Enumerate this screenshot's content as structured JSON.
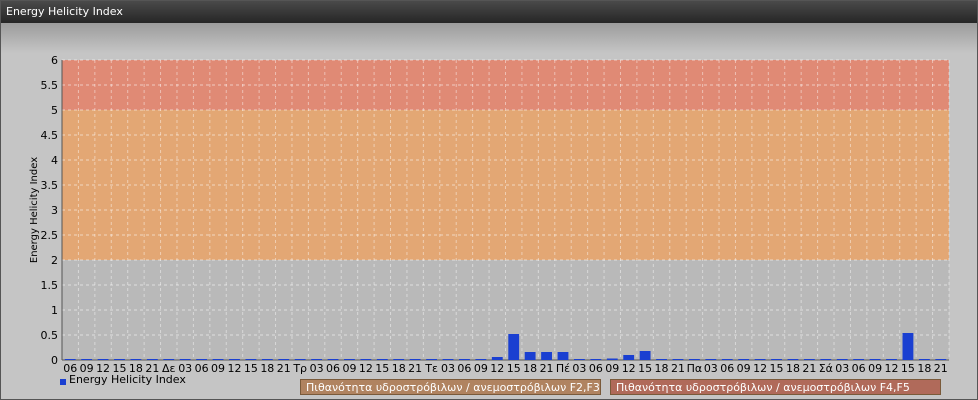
{
  "window": {
    "title": "Energy Helicity Index"
  },
  "legend": {
    "series_label": "Energy Helicity Index"
  },
  "probability_boxes": [
    {
      "label": "Πιθανότητα υδροστρόβιλων / ανεμοστρόβιλων F2,F3",
      "color": "#b08360"
    },
    {
      "label": "Πιθανότητα υδροστρόβιλων / ανεμοστρόβιλων F4,F5",
      "color": "#b06a5a"
    }
  ],
  "chart_data": {
    "type": "bar",
    "ylabel": "Energy Helicity Index",
    "ylim": [
      0,
      6
    ],
    "yticks": [
      "0",
      "0.5",
      "1",
      "1.5",
      "2",
      "2.5",
      "3",
      "3.5",
      "4",
      "4.5",
      "5",
      "5.5",
      "6"
    ],
    "grid": true,
    "legend_position": "bottom-left",
    "bands": [
      {
        "from": 0,
        "to": 2,
        "color": "#b9b9b9"
      },
      {
        "from": 2,
        "to": 5,
        "color": "#e3a774"
      },
      {
        "from": 5,
        "to": 6,
        "color": "#e08a75"
      }
    ],
    "categories": [
      "06",
      "09",
      "12",
      "15",
      "18",
      "21",
      "Δε",
      "03",
      "06",
      "09",
      "12",
      "15",
      "18",
      "21",
      "Τρ",
      "03",
      "06",
      "09",
      "12",
      "15",
      "18",
      "21",
      "Τε",
      "03",
      "06",
      "09",
      "12",
      "15",
      "18",
      "21",
      "Πέ",
      "03",
      "06",
      "09",
      "12",
      "15",
      "18",
      "21",
      "Πα",
      "03",
      "06",
      "09",
      "12",
      "15",
      "18",
      "21",
      "Σά",
      "03",
      "06",
      "09",
      "12",
      "15",
      "18",
      "21"
    ],
    "series": [
      {
        "color": "#1a3fd1",
        "values": [
          0.01,
          0.01,
          0.01,
          0.01,
          0.01,
          0.01,
          0.01,
          0.01,
          0.01,
          0.01,
          0.01,
          0.01,
          0.01,
          0.01,
          0.01,
          0.01,
          0.01,
          0.01,
          0.01,
          0.01,
          0.01,
          0.02,
          0.01,
          0.01,
          0.01,
          0.01,
          0.06,
          0.52,
          0.16,
          0.16,
          0.16,
          0.01,
          0.01,
          0.03,
          0.1,
          0.18,
          0.02,
          0.01,
          0.01,
          0.01,
          0.01,
          0.01,
          0.01,
          0.01,
          0.01,
          0.01,
          0.01,
          0.01,
          0.01,
          0.01,
          0.01,
          0.54,
          0.01,
          0.01
        ]
      }
    ]
  }
}
